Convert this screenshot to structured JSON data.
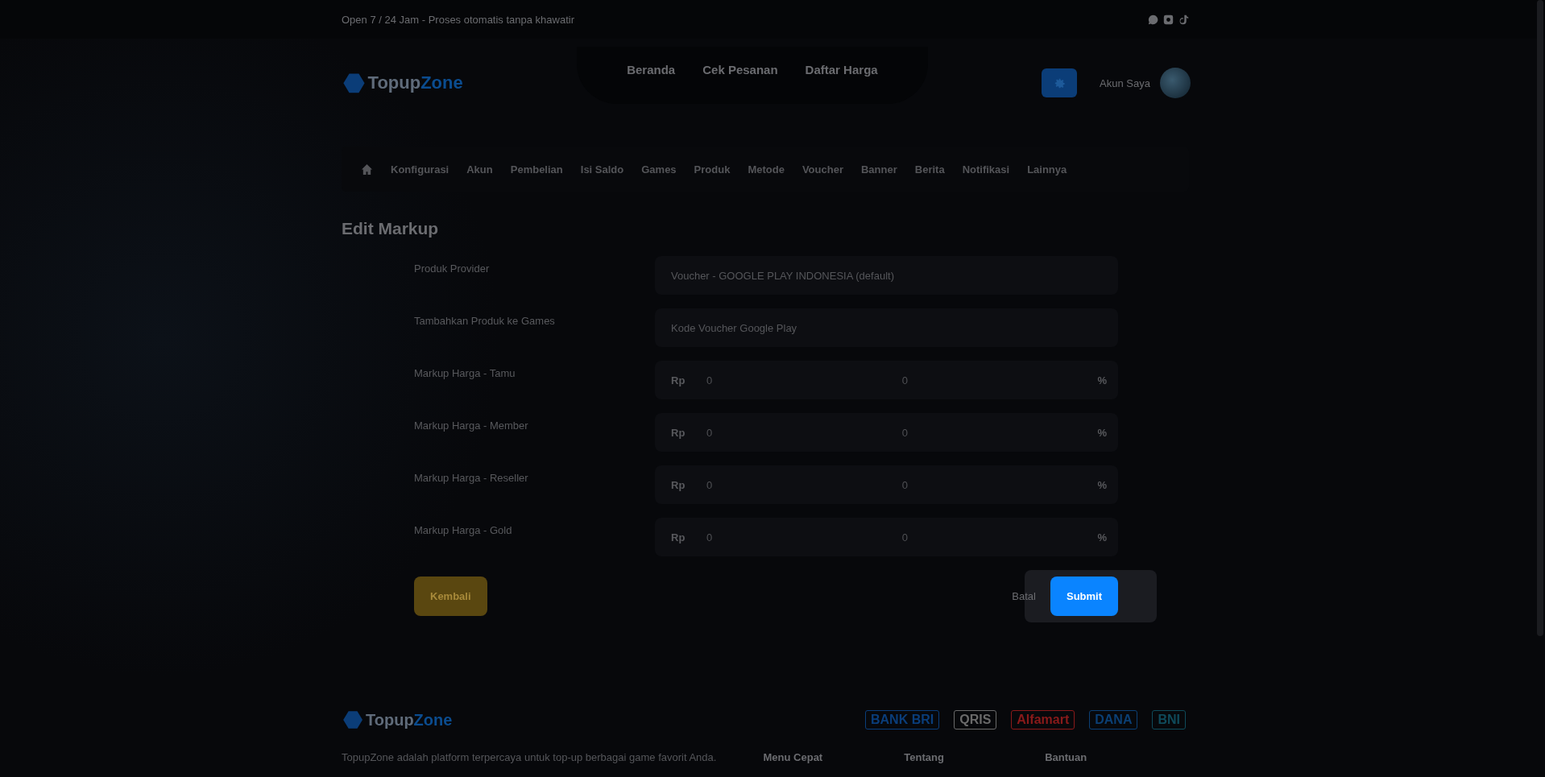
{
  "top_bar": {
    "tagline": "Open 7 / 24 Jam - Proses otomatis tanpa khawatir"
  },
  "header": {
    "logo": {
      "first": "Topup",
      "second": "Zone"
    },
    "nav": [
      {
        "label": "Beranda"
      },
      {
        "label": "Cek Pesanan"
      },
      {
        "label": "Daftar Harga"
      }
    ],
    "account_label": "Akun Saya"
  },
  "admin_menu": [
    {
      "label": "Konfigurasi"
    },
    {
      "label": "Akun"
    },
    {
      "label": "Pembelian"
    },
    {
      "label": "Isi Saldo"
    },
    {
      "label": "Games"
    },
    {
      "label": "Produk"
    },
    {
      "label": "Metode"
    },
    {
      "label": "Voucher"
    },
    {
      "label": "Banner"
    },
    {
      "label": "Berita"
    },
    {
      "label": "Notifikasi"
    },
    {
      "label": "Lainnya"
    }
  ],
  "page_title": "Edit Markup",
  "form": [
    {
      "kind": "text",
      "label": "Produk Provider",
      "value": "Voucher - GOOGLE PLAY INDONESIA (default)"
    },
    {
      "kind": "text",
      "label": "Tambahkan Produk ke Games",
      "value": "Kode Voucher Google Play"
    },
    {
      "kind": "markup",
      "label": "Markup Harga - Tamu",
      "prefix": "Rp",
      "amount": "0",
      "percent": "0",
      "suffix": "%"
    },
    {
      "kind": "markup",
      "label": "Markup Harga - Member",
      "prefix": "Rp",
      "amount": "0",
      "percent": "0",
      "suffix": "%"
    },
    {
      "kind": "markup",
      "label": "Markup Harga - Reseller",
      "prefix": "Rp",
      "amount": "0",
      "percent": "0",
      "suffix": "%"
    },
    {
      "kind": "markup",
      "label": "Markup Harga - Gold",
      "prefix": "Rp",
      "amount": "0",
      "percent": "0",
      "suffix": "%"
    }
  ],
  "actions": {
    "back": "Kembali",
    "cancel": "Batal",
    "submit": "Submit",
    "spotlight": true
  },
  "footer": {
    "logo": {
      "first": "Topup",
      "second": "Zone"
    },
    "payments": [
      {
        "name": "BANK BRI",
        "color": "#0a3d7a"
      },
      {
        "name": "QRIS",
        "color": "#6a6a6a"
      },
      {
        "name": "Alfamart",
        "color": "#8a1a1a"
      },
      {
        "name": "DANA",
        "color": "#0b3f74"
      },
      {
        "name": "BNI",
        "color": "#0f4a5a"
      }
    ],
    "description": "TopupZone adalah platform terpercaya untuk top-up berbagai game favorit Anda.",
    "columns": [
      {
        "title": "Menu Cepat"
      },
      {
        "title": "Tentang"
      },
      {
        "title": "Bantuan"
      }
    ]
  }
}
